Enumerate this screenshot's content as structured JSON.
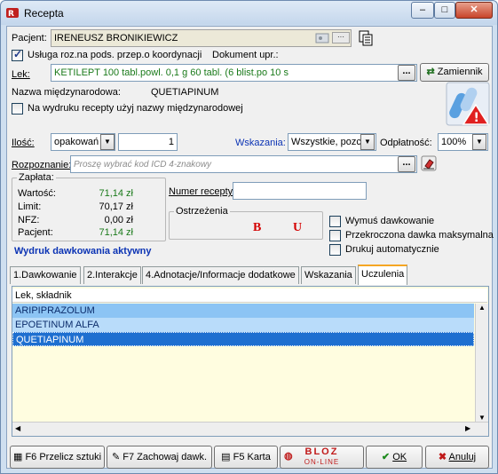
{
  "window": {
    "title": "Recepta",
    "minimize": "–",
    "maximize": "□",
    "close": "✕"
  },
  "patient": {
    "label": "Pacjent:",
    "value": "IRENEUSZ BRONIKIEWICZ"
  },
  "coordination": {
    "label": "Usługa roz.na pods. przep.o koordynacji",
    "checked": true,
    "doc_label": "Dokument upr.:"
  },
  "drug": {
    "label": "Lek:",
    "value": "KETILEPT 100 tabl.powl. 0,1 g 60 tabl. (6 blist.po 10 s",
    "dots": "...",
    "replacements_label": "Zamiennik"
  },
  "intl_name": {
    "label": "Nazwa międzynarodowa:",
    "value": "QUETIAPINUM"
  },
  "print_intl": {
    "label": "Na wydruku recepty użyj nazwy międzynarodowej",
    "checked": false
  },
  "quantity": {
    "label": "Ilość:",
    "unit": "opakowań",
    "value": "1"
  },
  "indications": {
    "label": "Wskazania:",
    "value": "Wszystkie, pozc"
  },
  "payment_level": {
    "label": "Odpłatność:",
    "value": "100%"
  },
  "diagnosis": {
    "label": "Rozpoznanie:",
    "placeholder": "Proszę wybrać kod ICD 4-znakowy",
    "dots": "..."
  },
  "payment": {
    "title": "Zapłata:",
    "rows": [
      {
        "label": "Wartość:",
        "value": "71,14 zł",
        "color": "#1a7a1a"
      },
      {
        "label": "Limit:",
        "value": "70,17 zł",
        "color": "#000000"
      },
      {
        "label": "NFZ:",
        "value": "0,00 zł",
        "color": "#000000"
      },
      {
        "label": "Pacjent:",
        "value": "71,14 zł",
        "color": "#1a7a1a"
      }
    ]
  },
  "prescription_number": {
    "label": "Numer recepty:",
    "value": ""
  },
  "warnings": {
    "title": "Ostrzeżenia",
    "b": "B",
    "u": "U"
  },
  "dosage_active": "Wydruk dawkowania aktywny",
  "options": {
    "print_dosage": "Wymuś dawkowanie",
    "max_dose": "Przekroczona dawka maksymalna",
    "auto_print": "Drukuj automatycznie"
  },
  "tabs": [
    {
      "label": "1.Dawkowanie"
    },
    {
      "label": "2.Interakcje"
    },
    {
      "label": "4.Adnotacje/Informacje dodatkowe"
    },
    {
      "label": "Wskazania"
    },
    {
      "label": "Uczulenia"
    }
  ],
  "list": {
    "header": "Lek, składnik",
    "items": [
      "ARIPIPRAZOLUM",
      "EPOETINUM ALFA",
      "QUETIAPINUM"
    ]
  },
  "footer": {
    "recalc": "F6 Przelicz sztuki",
    "save_dosage": "F7 Zachowaj dawk.",
    "card": "F5 Karta",
    "bloz_top": "BLOZ",
    "bloz_bottom": "ON-LINE",
    "ok": "OK",
    "cancel": "Anuluj"
  },
  "colors": {
    "accent_orange": "#f5a623",
    "selection_blue": "#1e6fd0",
    "warning_red": "#d40000"
  }
}
